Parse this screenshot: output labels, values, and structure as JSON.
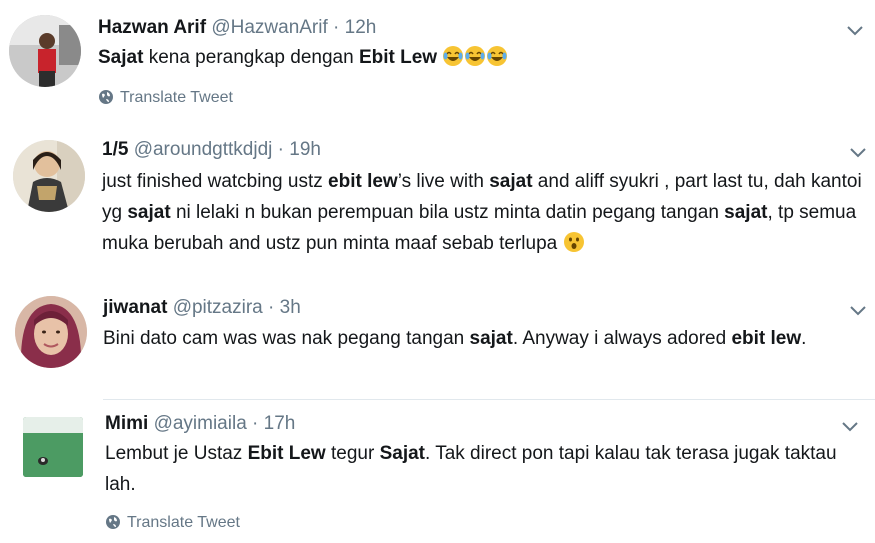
{
  "tweets": [
    {
      "name": "Hazwan Arif",
      "handle": "@HazwanArif",
      "sep": "·",
      "time": "12h",
      "segments": [
        {
          "t": "Sajat",
          "b": true
        },
        {
          "t": " kena perangkap dengan ",
          "b": false
        },
        {
          "t": "Ebit Lew",
          "b": true
        },
        {
          "t": " ",
          "b": false
        }
      ],
      "emojis": [
        "laughing-tears",
        "laughing-tears",
        "laughing-tears"
      ],
      "translate": "Translate Tweet"
    },
    {
      "name": "1/5",
      "handle": "@aroundgttkdjdj",
      "sep": "·",
      "time": "19h",
      "segments": [
        {
          "t": "just finished watcbing ustz ",
          "b": false
        },
        {
          "t": "ebit lew",
          "b": true
        },
        {
          "t": "’s live with ",
          "b": false
        },
        {
          "t": "sajat",
          "b": true
        },
        {
          "t": " and aliff syukri , part last tu, dah kantoi yg ",
          "b": false
        },
        {
          "t": "sajat",
          "b": true
        },
        {
          "t": " ni lelaki n bukan perempuan bila ustz minta datin pegang tangan ",
          "b": false
        },
        {
          "t": "sajat",
          "b": true
        },
        {
          "t": ", tp semua muka berubah and ustz pun minta maaf sebab terlupa ",
          "b": false
        }
      ],
      "emojis": [
        "surprised-face"
      ]
    },
    {
      "name": "jiwanat",
      "handle": "@pitzazira",
      "sep": "·",
      "time": "3h",
      "segments": [
        {
          "t": "Bini dato cam was was nak pegang tangan ",
          "b": false
        },
        {
          "t": "sajat",
          "b": true
        },
        {
          "t": ". Anyway i always adored ",
          "b": false
        },
        {
          "t": "ebit lew",
          "b": true
        },
        {
          "t": ".",
          "b": false
        }
      ],
      "emojis": []
    },
    {
      "name": "Mimi",
      "handle": "@ayimiaila",
      "sep": "·",
      "time": "17h",
      "segments": [
        {
          "t": "Lembut je Ustaz ",
          "b": false
        },
        {
          "t": "Ebit Lew",
          "b": true
        },
        {
          "t": " tegur ",
          "b": false
        },
        {
          "t": "Sajat",
          "b": true
        },
        {
          "t": ". Tak direct pon tapi kalau tak terasa jugak taktau lah.",
          "b": false
        }
      ],
      "emojis": [],
      "translate": "Translate Tweet"
    }
  ],
  "icons": {
    "caret": "chevron-down-icon",
    "translate": "globe-icon"
  },
  "colors": {
    "secondary_text": "#657786",
    "primary_text": "#14171a",
    "divider": "#e1e8ed",
    "emoji_yellow": "#f7c433"
  }
}
